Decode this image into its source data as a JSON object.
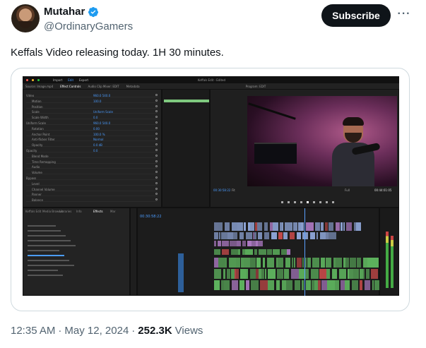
{
  "author": {
    "name": "Mutahar",
    "handle": "@OrdinaryGamers",
    "verified_icon": "verified-badge-icon",
    "verified_color": "#1d9bf0"
  },
  "actions": {
    "subscribe_label": "Subscribe",
    "more_label": "···"
  },
  "tweet": {
    "text": "Keffals Video releasing today. 1H 30 minutes."
  },
  "meta": {
    "time": "12:35 AM",
    "separator": "·",
    "date": "May 12, 2024",
    "views_count": "252.3K",
    "views_label": "Views"
  },
  "premiere": {
    "menu": [
      "Import",
      "Edit",
      "Export"
    ],
    "active_menu": "Edit",
    "window_title": "Keffals Edit - Edited",
    "workspace_tabs": [
      "Source: Image.mp4",
      "Effect Controls",
      "Audio Clip Mixer: EDIT",
      "Metadata"
    ],
    "active_tab": "Effect Controls",
    "program_label": "Program: EDIT",
    "program_timecode": "00:30:58:22",
    "program_end_timecode": "00:44:01:05",
    "fit_label": "Fit",
    "quality_label": "Full",
    "timeline_timecode": "00:30:58:22",
    "timeline_tabs": [
      "Keffals Edit",
      "Media Browser",
      "Libraries",
      "Info",
      "Effects",
      "Mar"
    ],
    "effect_rows": [
      "Video",
      "Motion",
      "Position",
      "Scale",
      "Scale Width",
      "Uniform Scale",
      "Rotation",
      "Anchor Point",
      "Anti-flicker Filter",
      "Opacity",
      "Opacity",
      "Blend Mode",
      "Time Remapping",
      "Audio",
      "Volume",
      "Bypass",
      "Level",
      "Channel Volume",
      "Panner",
      "Balance"
    ],
    "effect_values": [
      "960.0  540.0",
      "100.0",
      "",
      "Uniform Scale",
      "0.0",
      "960.0  540.0",
      "0.00",
      "100.0 %",
      "Normal",
      "0.0 dB",
      "0.0"
    ],
    "colors": {
      "accent": "#4b9cff",
      "video_clip": "#8fa6d8",
      "audio_clip": "#5fb65f",
      "purple_clip": "#b07cc6",
      "red_clip": "#c94a4a"
    }
  }
}
